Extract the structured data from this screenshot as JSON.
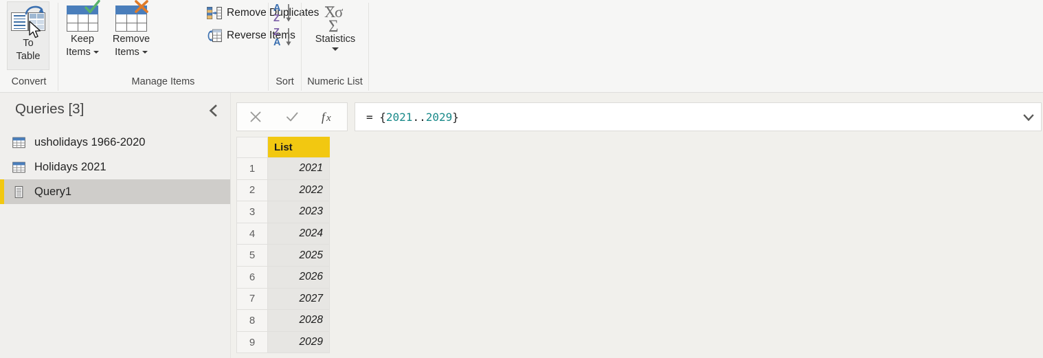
{
  "ribbon": {
    "groups": [
      {
        "name": "convert",
        "label": "Convert"
      },
      {
        "name": "manage-items",
        "label": "Manage Items"
      },
      {
        "name": "sort",
        "label": "Sort"
      },
      {
        "name": "numeric-list",
        "label": "Numeric List"
      }
    ],
    "to_table": {
      "line1": "To",
      "line2": "Table"
    },
    "keep_items": {
      "line1": "Keep",
      "line2": "Items"
    },
    "remove_items": {
      "line1": "Remove",
      "line2": "Items"
    },
    "remove_duplicates": "Remove Duplicates",
    "reverse_items": "Reverse Items",
    "statistics": "Statistics",
    "sort_asc_icon": "sort-ascending-icon",
    "sort_desc_icon": "sort-descending-icon"
  },
  "queries": {
    "title": "Queries [3]",
    "collapse_icon": "chevron-left-icon",
    "items": [
      {
        "label": "usholidays 1966-2020",
        "icon": "table-icon",
        "selected": false
      },
      {
        "label": "Holidays 2021",
        "icon": "table-icon",
        "selected": false
      },
      {
        "label": "Query1",
        "icon": "list-icon",
        "selected": true
      }
    ]
  },
  "formula_bar": {
    "cancel_icon": "close-icon",
    "accept_icon": "check-icon",
    "fx_icon": "fx-icon",
    "prefix": "= ",
    "expression_open": "{",
    "range_start": "2021",
    "range_dots": "..",
    "range_end": "2029",
    "expression_close": "}",
    "full_text": "= {2021..2029}",
    "dropdown_icon": "chevron-down-icon"
  },
  "preview": {
    "column_header": "List",
    "rows": [
      {
        "index": "1",
        "value": "2021"
      },
      {
        "index": "2",
        "value": "2022"
      },
      {
        "index": "3",
        "value": "2023"
      },
      {
        "index": "4",
        "value": "2024"
      },
      {
        "index": "5",
        "value": "2025"
      },
      {
        "index": "6",
        "value": "2026"
      },
      {
        "index": "7",
        "value": "2027"
      },
      {
        "index": "8",
        "value": "2028"
      },
      {
        "index": "9",
        "value": "2029"
      }
    ]
  },
  "colors": {
    "accent_yellow": "#f2c811",
    "header_blue": "#4a7ebb",
    "check_green": "#58b36b",
    "cross_orange": "#e07b28",
    "sort_blue": "#3a6fb0",
    "sort_purple": "#7b5ea7",
    "selection_grey": "#cfcdca",
    "pane_bg": "#f0efed",
    "preview_bg": "#f1f0ec",
    "number_teal": "#1a8a8a"
  }
}
